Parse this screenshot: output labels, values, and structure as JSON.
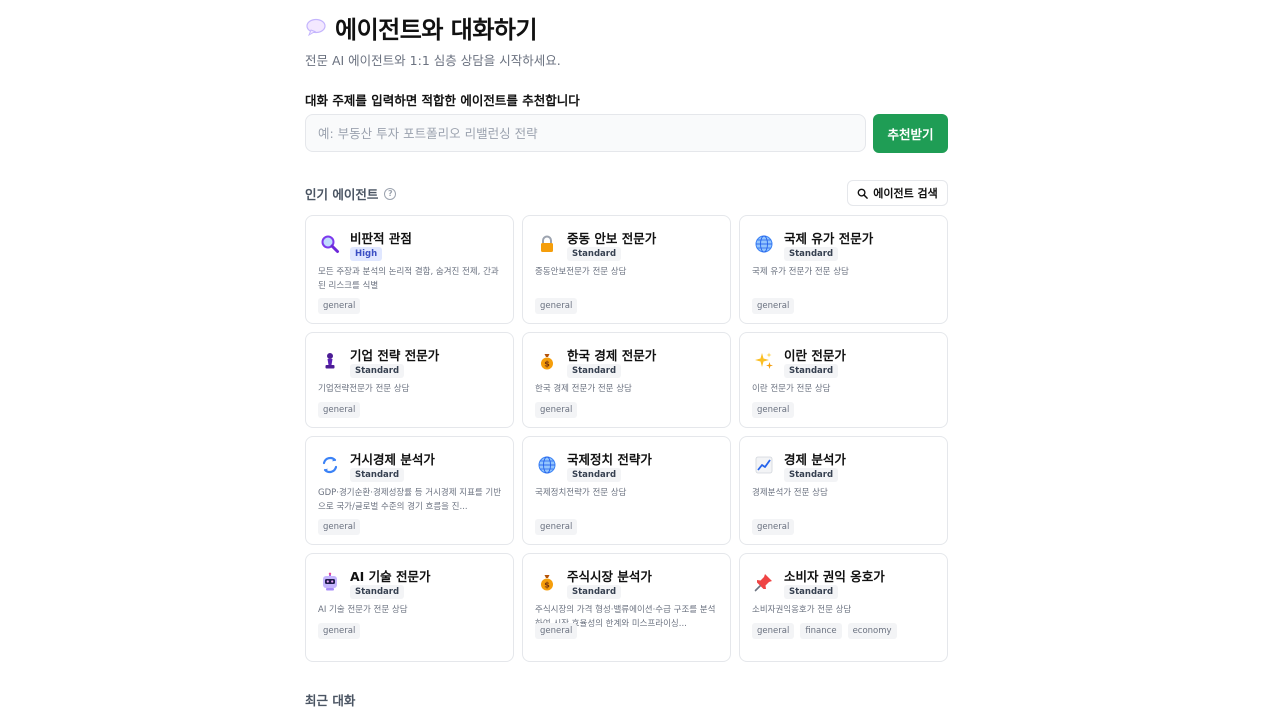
{
  "header": {
    "title": "에이전트와 대화하기",
    "subtitle": "전문 AI 에이전트와 1:1 심층 상담을 시작하세요."
  },
  "recommend": {
    "label": "대화 주제를 입력하면 적합한 에이전트를 추천합니다",
    "placeholder": "예: 부동산 투자 포트폴리오 리밸런싱 전략",
    "button": "추천받기"
  },
  "popular": {
    "title": "인기 에이전트",
    "help": "?",
    "search_button": "에이전트 검색"
  },
  "agents": [
    {
      "name": "비판적 관점",
      "tier": "High",
      "desc": "모든 주장과 분석의 논리적 결함, 숨겨진 전제, 간과된 리스크를 식별",
      "tags": [
        "general"
      ],
      "icon": "magnifier-icon"
    },
    {
      "name": "중동 안보 전문가",
      "tier": "Standard",
      "desc": "중동안보전문가 전문 상담",
      "tags": [
        "general"
      ],
      "icon": "lock-icon"
    },
    {
      "name": "국제 유가 전문가",
      "tier": "Standard",
      "desc": "국제 유가 전문가 전문 상담",
      "tags": [
        "general"
      ],
      "icon": "globe-icon"
    },
    {
      "name": "기업 전략 전문가",
      "tier": "Standard",
      "desc": "기업전략전문가 전문 상담",
      "tags": [
        "general"
      ],
      "icon": "chess-pawn-icon"
    },
    {
      "name": "한국 경제 전문가",
      "tier": "Standard",
      "desc": "한국 경제 전문가 전문 상담",
      "tags": [
        "general"
      ],
      "icon": "money-bag-icon"
    },
    {
      "name": "이란 전문가",
      "tier": "Standard",
      "desc": "이란 전문가 전문 상담",
      "tags": [
        "general"
      ],
      "icon": "sparkles-icon"
    },
    {
      "name": "거시경제 분석가",
      "tier": "Standard",
      "desc": "GDP·경기순환·경제성장률 등 거시경제 지표를 기반으로 국가/글로벌 수준의 경기 흐름을 진...",
      "tags": [
        "general"
      ],
      "icon": "cycle-arrows-icon"
    },
    {
      "name": "국제정치 전략가",
      "tier": "Standard",
      "desc": "국제정치전략가 전문 상담",
      "tags": [
        "general"
      ],
      "icon": "globe-icon"
    },
    {
      "name": "경제 분석가",
      "tier": "Standard",
      "desc": "경제분석가 전문 상담",
      "tags": [
        "general"
      ],
      "icon": "chart-up-icon"
    },
    {
      "name": "AI 기술 전문가",
      "tier": "Standard",
      "desc": "AI 기술 전문가 전문 상담",
      "tags": [
        "general"
      ],
      "icon": "robot-icon"
    },
    {
      "name": "주식시장 분석가",
      "tier": "Standard",
      "desc": "주식시장의 가격 형성·밸류에이션·수급 구조를 분석하여 시장 효율성의 한계와 미스프라이싱...",
      "tags": [
        "general"
      ],
      "icon": "money-bag-icon"
    },
    {
      "name": "소비자 권익 옹호가",
      "tier": "Standard",
      "desc": "소비자권익옹호가 전문 상담",
      "tags": [
        "general",
        "finance",
        "economy"
      ],
      "icon": "pushpin-icon"
    }
  ],
  "recent": {
    "title": "최근 대화"
  }
}
